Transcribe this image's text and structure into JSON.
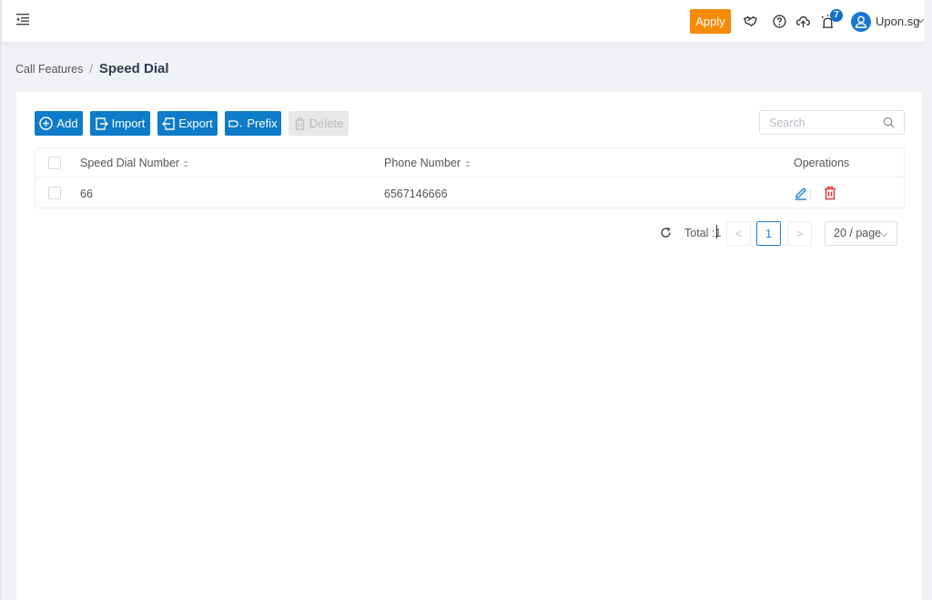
{
  "topbar": {
    "menu_toggle_icon": "menu-fold-icon",
    "apply_label": "Apply",
    "icons": [
      "handshake-icon",
      "help-circle-icon",
      "cloud-upload-icon",
      "alarm-icon"
    ],
    "notification_count": "7",
    "user_name": "Upon.sg",
    "colors": {
      "apply": "#f58a07",
      "avatar": "#1677d2"
    }
  },
  "breadcrumb": {
    "parent": "Call Features",
    "separator": "/",
    "current": "Speed Dial"
  },
  "toolbar": {
    "add_label": "Add",
    "import_label": "Import",
    "export_label": "Export",
    "prefix_label": "Prefix",
    "delete_label": "Delete",
    "search_placeholder": "Search",
    "search_value": ""
  },
  "table": {
    "columns": [
      "Speed Dial Number",
      "Phone Number",
      "Operations"
    ],
    "rows": [
      {
        "speed_dial_number": "66",
        "phone_number": "6567146666"
      }
    ]
  },
  "pagination": {
    "total_label": "Total :1",
    "current_page": "1",
    "page_size": "20 / page",
    "prev": "<",
    "next": ">"
  },
  "colors": {
    "primary": "#0e7cc9",
    "edit": "#1a82d3",
    "delete": "#e0383e"
  }
}
